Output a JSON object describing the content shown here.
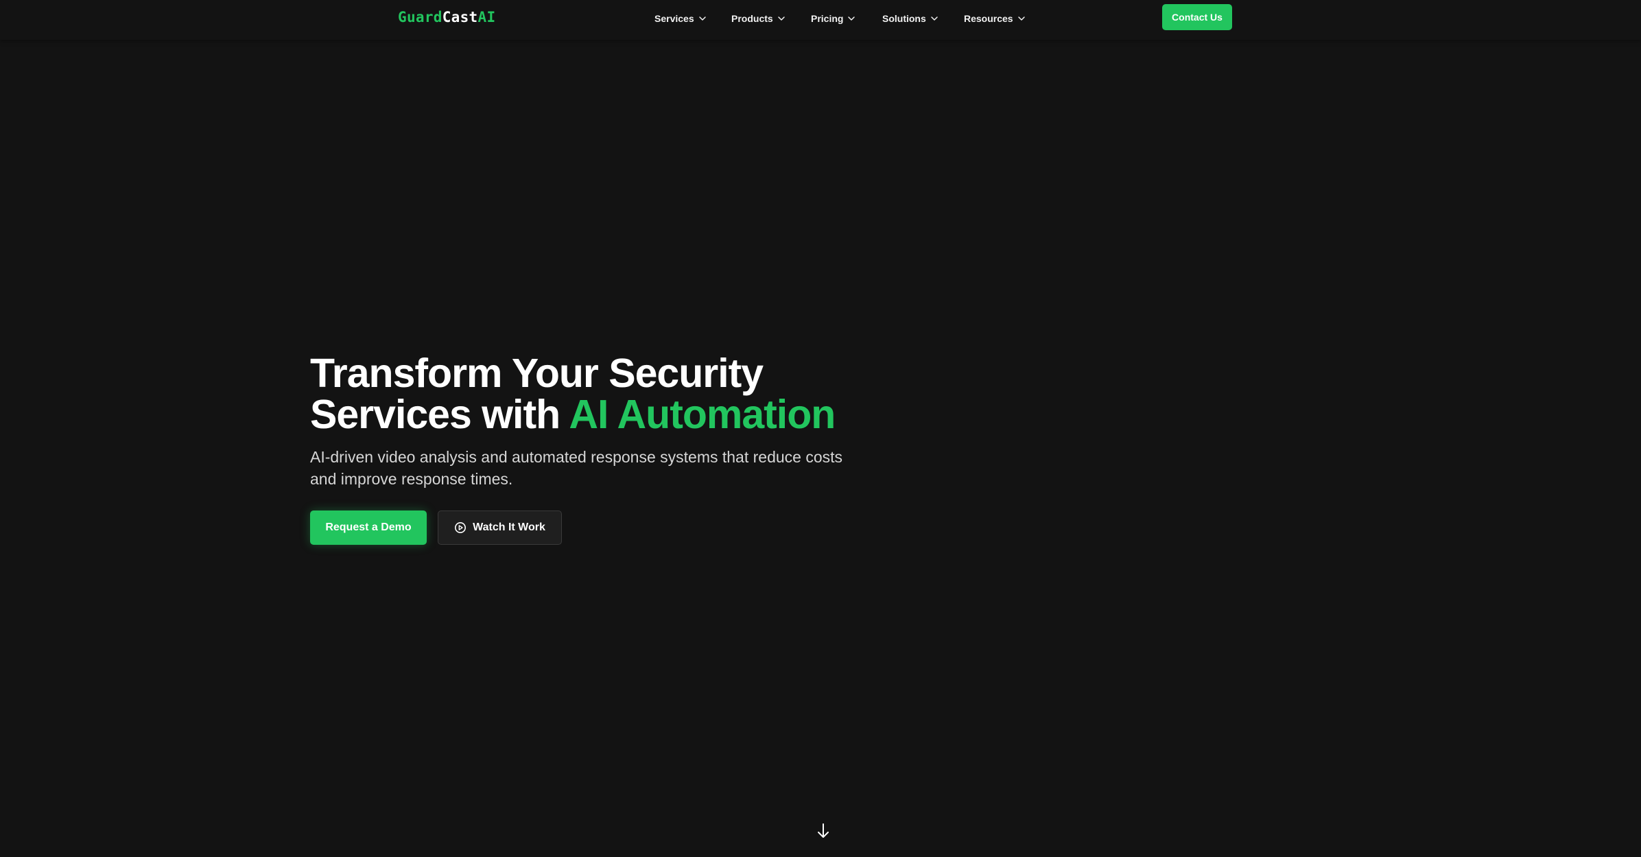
{
  "header": {
    "logo": {
      "part1": "Guard",
      "part2": "Cast",
      "part3": "AI"
    },
    "nav": [
      {
        "label": "Services"
      },
      {
        "label": "Products"
      },
      {
        "label": "Pricing"
      },
      {
        "label": "Solutions"
      },
      {
        "label": "Resources"
      }
    ],
    "contact_label": "Contact Us"
  },
  "hero": {
    "title_line1": "Transform Your Security",
    "title_line2_plain": "Services with ",
    "title_line2_accent": "AI Automation",
    "subtitle": "AI-driven video analysis and automated response systems that reduce costs and improve response times.",
    "primary_button": "Request a Demo",
    "secondary_button": "Watch It Work",
    "secondary_icon": "play-circle-icon",
    "scroll_icon": "arrow-down-icon"
  },
  "colors": {
    "background": "#131313",
    "accent": "#22c55e",
    "text": "#ffffff",
    "muted": "#d6d6d6"
  }
}
